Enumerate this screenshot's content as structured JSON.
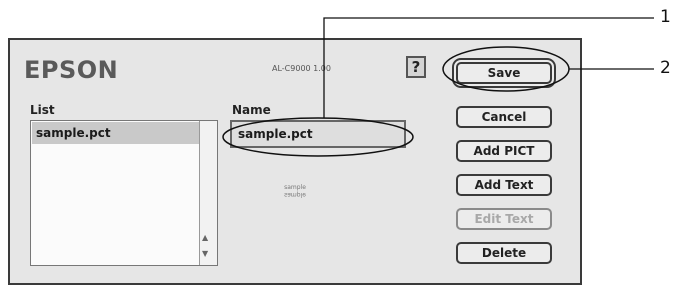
{
  "dialog": {
    "brand": "EPSON",
    "model": "AL-C9000 1.00",
    "help_label": "?",
    "list_label": "List",
    "name_label": "Name",
    "list_items": [
      "sample.pct"
    ],
    "name_value": "sample.pct",
    "preview_text": "sample"
  },
  "buttons": {
    "save": "Save",
    "cancel": "Cancel",
    "add_pict": "Add PICT",
    "add_text": "Add Text",
    "edit_text": "Edit Text",
    "delete": "Delete"
  },
  "callouts": {
    "one": "1",
    "two": "2"
  }
}
